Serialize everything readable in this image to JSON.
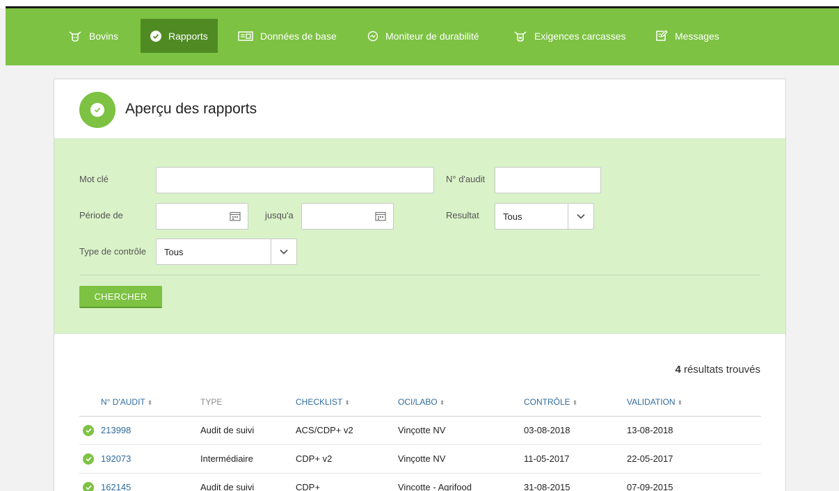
{
  "nav": {
    "items": [
      {
        "label": "Bovins",
        "icon": "cow-icon"
      },
      {
        "label": "Rapports",
        "icon": "check-circle-icon",
        "active": true
      },
      {
        "label": "Données de base",
        "icon": "id-card-icon"
      },
      {
        "label": "Moniteur de durabilité",
        "icon": "gauge-icon"
      },
      {
        "label": "Exigences carcasses",
        "icon": "carcass-icon"
      },
      {
        "label": "Messages",
        "icon": "message-edit-icon"
      }
    ]
  },
  "page": {
    "title": "Aperçu des rapports"
  },
  "filters": {
    "keyword_label": "Mot clé",
    "keyword_value": "",
    "audit_no_label": "N° d'audit",
    "audit_no_value": "",
    "period_label": "Période de",
    "period_from_value": "",
    "until_label": "jusqu'a",
    "period_to_value": "",
    "result_label": "Resultat",
    "result_value": "Tous",
    "type_label": "Type de contrôle",
    "type_value": "Tous",
    "search_button": "CHERCHER"
  },
  "results": {
    "count": "4",
    "count_suffix": "résultats trouvés"
  },
  "table": {
    "headers": {
      "audit": "N° D'AUDIT",
      "type": "TYPE",
      "checklist": "CHECKLIST",
      "oci": "OCI/LABO",
      "control": "CONTRÔLE",
      "validation": "VALIDATION"
    },
    "sort_icon": "⬍",
    "rows": [
      {
        "audit": "213998",
        "type": "Audit de suivi",
        "checklist": "ACS/CDP+ v2",
        "oci": "Vinçotte NV",
        "control": "03-08-2018",
        "validation": "13-08-2018"
      },
      {
        "audit": "192073",
        "type": "Intermédiaire",
        "checklist": "CDP+ v2",
        "oci": "Vinçotte NV",
        "control": "11-05-2017",
        "validation": "22-05-2017"
      },
      {
        "audit": "162145",
        "type": "Audit de suivi",
        "checklist": "CDP+",
        "oci": "Vincotte - Agrifood",
        "control": "31-08-2015",
        "validation": "07-09-2015"
      }
    ]
  },
  "colors": {
    "brand_green": "#7dc242",
    "active_green": "#4f8a23",
    "filter_bg": "#d9f2c8",
    "link_blue": "#2f6b9e"
  }
}
